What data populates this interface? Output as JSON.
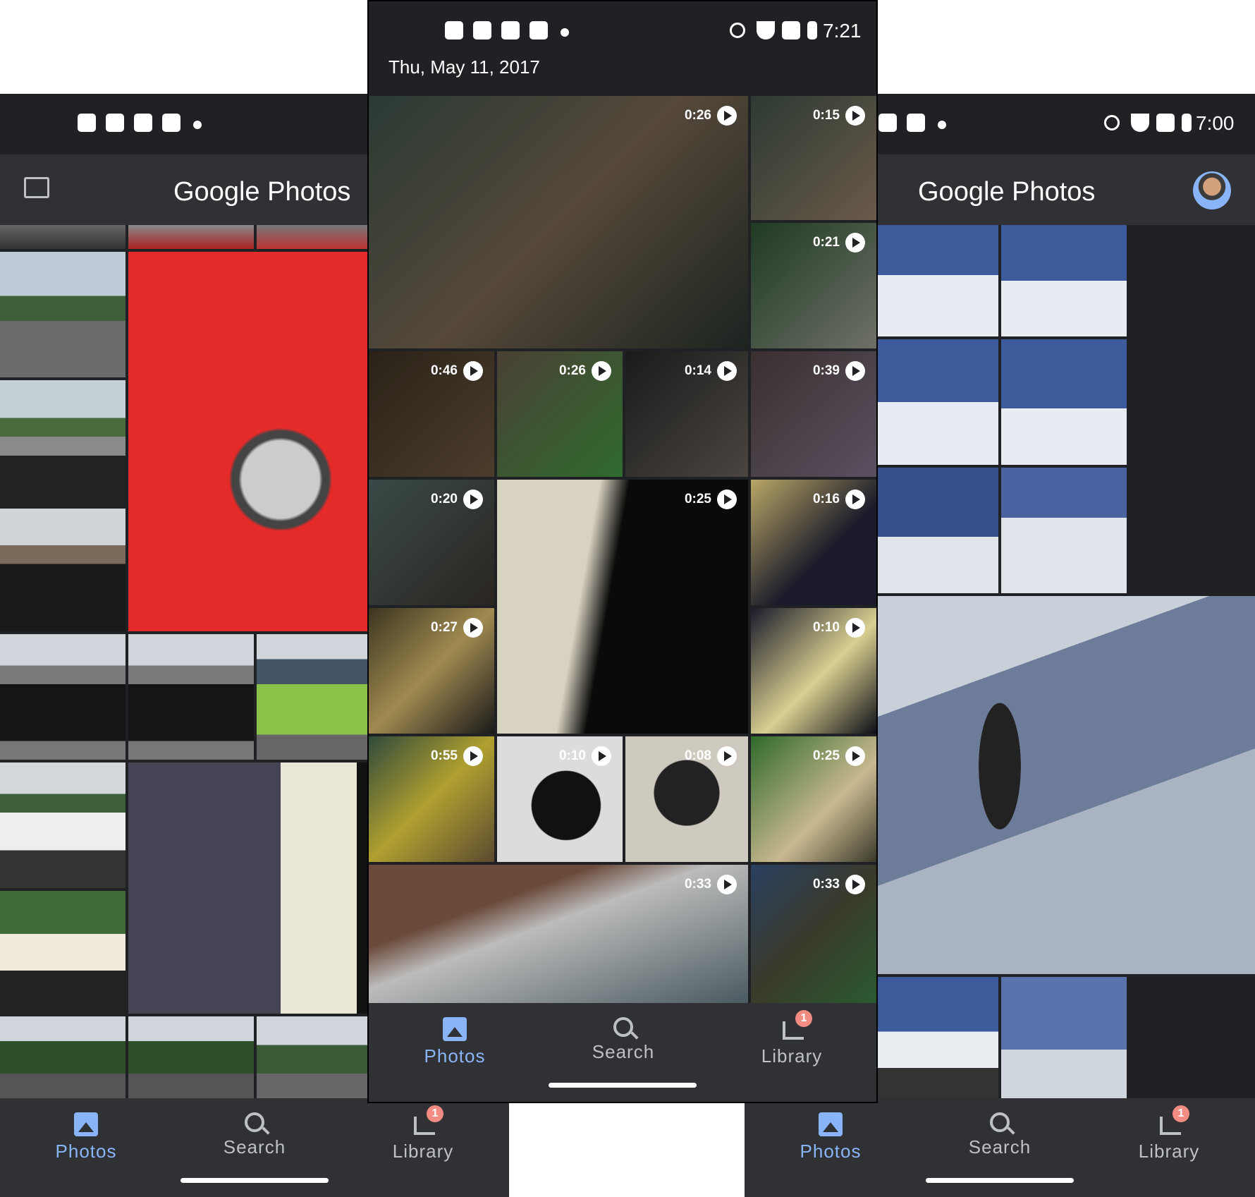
{
  "left_screen": {
    "app_title": "Google Photos",
    "nav": [
      {
        "label": "Photos",
        "active": true
      },
      {
        "label": "Search",
        "active": false
      },
      {
        "label": "Library",
        "active": false,
        "badge": "1"
      }
    ]
  },
  "center_screen": {
    "status_time": "7:21",
    "date_header": "Thu, May 11, 2017",
    "video_durations": [
      "0:26",
      "0:15",
      "0:21",
      "0:46",
      "0:26",
      "0:14",
      "0:39",
      "0:20",
      "0:25",
      "0:16",
      "0:27",
      "0:10",
      "0:55",
      "0:10",
      "0:08",
      "0:25",
      "0:33",
      "0:33"
    ],
    "nav": [
      {
        "label": "Photos",
        "active": true
      },
      {
        "label": "Search",
        "active": false
      },
      {
        "label": "Library",
        "active": false,
        "badge": "1"
      }
    ]
  },
  "right_screen": {
    "status_time": "7:00",
    "app_title": "Google Photos",
    "nav": [
      {
        "label": "Photos",
        "active": true
      },
      {
        "label": "Search",
        "active": false
      },
      {
        "label": "Library",
        "active": false,
        "badge": "1"
      }
    ]
  },
  "colors": {
    "background": "#202124",
    "bar": "#303134",
    "accent": "#8ab4f8",
    "badge": "#f28b82"
  }
}
